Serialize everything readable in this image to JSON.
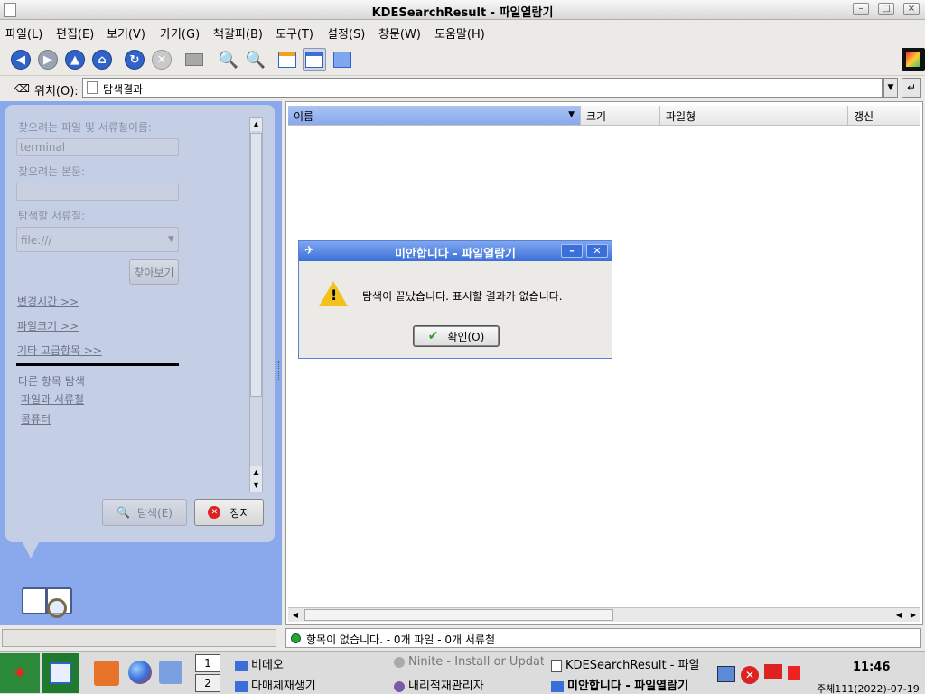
{
  "window": {
    "title": "KDESearchResult - 파일열람기"
  },
  "menu": [
    "파일(L)",
    "편집(E)",
    "보기(V)",
    "가기(G)",
    "책갈피(B)",
    "도구(T)",
    "설정(S)",
    "창문(W)",
    "도움말(H)"
  ],
  "location": {
    "label": "위치(O):",
    "value": "탐색결과"
  },
  "search_panel": {
    "name_label": "찾으려는 파일 및 서류철이름:",
    "name_value": "terminal",
    "content_label": "찾으려는 본문:",
    "content_value": "",
    "folder_label": "탐색할 서류철:",
    "folder_value": "file:///",
    "browse_button": "찾아보기",
    "modified_link": "변경시간 >>",
    "filesize_link": "파일크기 >>",
    "advanced_link": "기타 고급항목 >>",
    "other_title": "다른 항목 탐색",
    "other_files": "파일과 서류철",
    "other_computer": "콤퓨터",
    "search_button": "탐색(E)",
    "stop_button": "정지"
  },
  "columns": [
    "이름",
    "크기",
    "파일형",
    "갱신"
  ],
  "status": {
    "text": "항목이 없습니다. - 0개 파일 - 0개 서류철",
    "indicator_color": "#22aa22"
  },
  "dialog": {
    "title": "미안합니다 - 파일열람기",
    "message": "탐색이 끝났습니다. 표시할 결과가 없습니다.",
    "ok_button": "확인(O)"
  },
  "taskbar": {
    "desktops": [
      "1",
      "2"
    ],
    "tasks": [
      {
        "label": "비데오"
      },
      {
        "label": "Ninite - Install or Updat"
      },
      {
        "label": "KDESearchResult - 파일"
      },
      {
        "label": "다매체재생기"
      },
      {
        "label": "내리적재관리자"
      },
      {
        "label": "미안합니다 - 파일열람기"
      }
    ],
    "time": "11:46",
    "date": "주체111(2022)-07-19"
  },
  "colors": {
    "accent": "#3a6fd9",
    "sidebar": "#8aa9ec",
    "panel": "#c4cfe6",
    "warning": "#f2c21b"
  }
}
